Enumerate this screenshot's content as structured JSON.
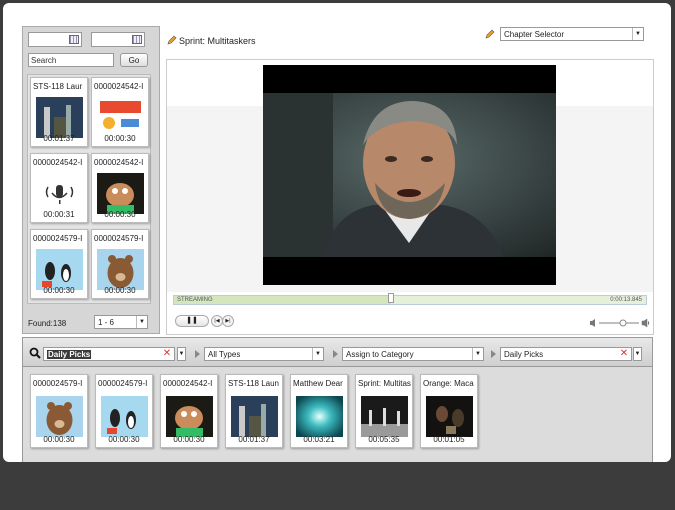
{
  "left_panel": {
    "search_placeholder": "Search",
    "go_label": "Go",
    "found_label": "Found:138",
    "pager_value": "1 - 6",
    "items": [
      {
        "title": "STS-118 Laur",
        "duration": "00:01:37",
        "thumb": "shuttle"
      },
      {
        "title": "0000024542-I",
        "duration": "00:00:30",
        "thumb": "cartoon-red"
      },
      {
        "title": "0000024542-I",
        "duration": "00:00:31",
        "thumb": "audio-icon"
      },
      {
        "title": "0000024542-I",
        "duration": "00:00:30",
        "thumb": "muppet"
      },
      {
        "title": "0000024579-I",
        "duration": "00:00:30",
        "thumb": "penguins"
      },
      {
        "title": "0000024579-I",
        "duration": "00:00:30",
        "thumb": "bear"
      }
    ]
  },
  "player": {
    "title": "Sprint: Multitaskers",
    "chapter_selector": "Chapter Selector",
    "status_text": "STREAMING",
    "time_text": "0:00:13.845",
    "progress_fraction": 0.46,
    "volume_fraction": 0.6
  },
  "filter_bar": {
    "search_value": "Daily Picks",
    "type_filter": "All Types",
    "assign_category": "Assign to Category",
    "category_value": "Daily Picks"
  },
  "picks": [
    {
      "title": "0000024579-I",
      "duration": "00:00:30",
      "thumb": "bear"
    },
    {
      "title": "0000024579-I",
      "duration": "00:00:30",
      "thumb": "penguins"
    },
    {
      "title": "0000024542-I",
      "duration": "00:00:30",
      "thumb": "muppet"
    },
    {
      "title": "STS-118 Laun",
      "duration": "00:01:37",
      "thumb": "shuttle"
    },
    {
      "title": "Matthew Dear",
      "duration": "00:03:21",
      "thumb": "teal-light"
    },
    {
      "title": "Sprint: Multitas",
      "duration": "00:05:35",
      "thumb": "stage"
    },
    {
      "title": "Orange: Maca",
      "duration": "00:01:05",
      "thumb": "dark-scene"
    }
  ],
  "colors": {
    "background": "#3c3c3c",
    "panel": "#d6d6d6",
    "accent_red": "#d33333"
  }
}
